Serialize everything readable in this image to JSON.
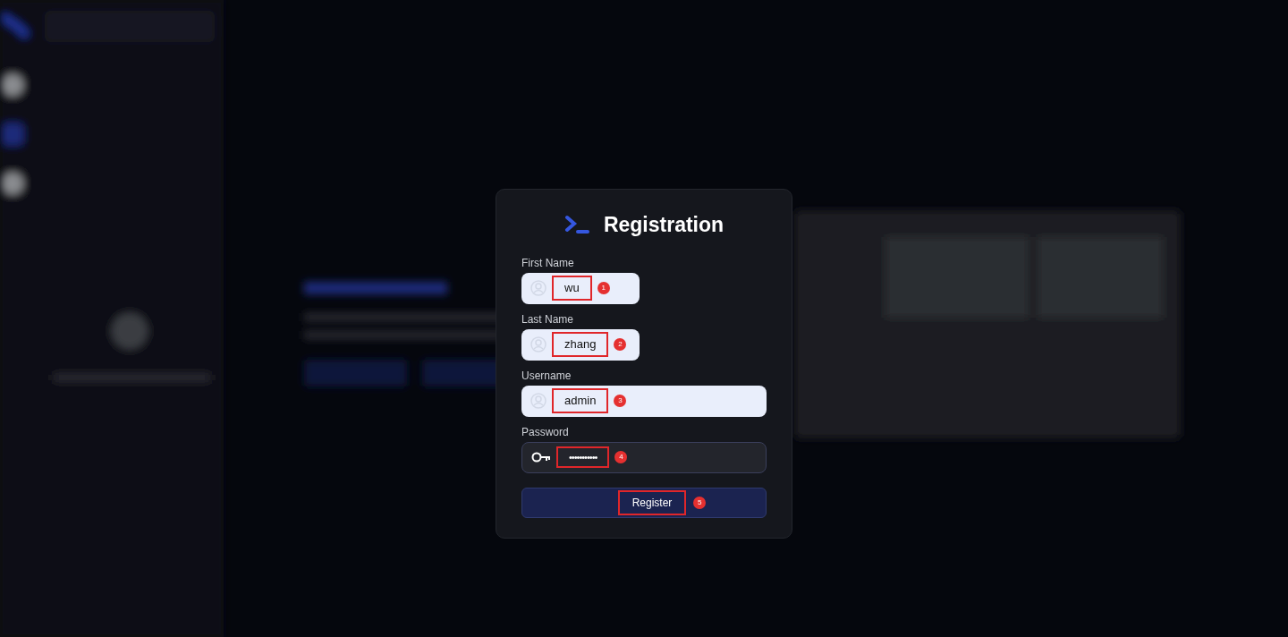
{
  "dialog": {
    "title": "Registration"
  },
  "fields": [
    {
      "label": "First Name",
      "value": "wu",
      "kind": "text",
      "annotation": "1"
    },
    {
      "label": "Last Name",
      "value": "zhang",
      "kind": "text",
      "annotation": "2"
    },
    {
      "label": "Username",
      "value": "admin",
      "kind": "text",
      "annotation": "3"
    },
    {
      "label": "Password",
      "value": "•••••••••••",
      "kind": "password",
      "annotation": "4"
    }
  ],
  "submit": {
    "label": "Register",
    "annotation": "5"
  }
}
